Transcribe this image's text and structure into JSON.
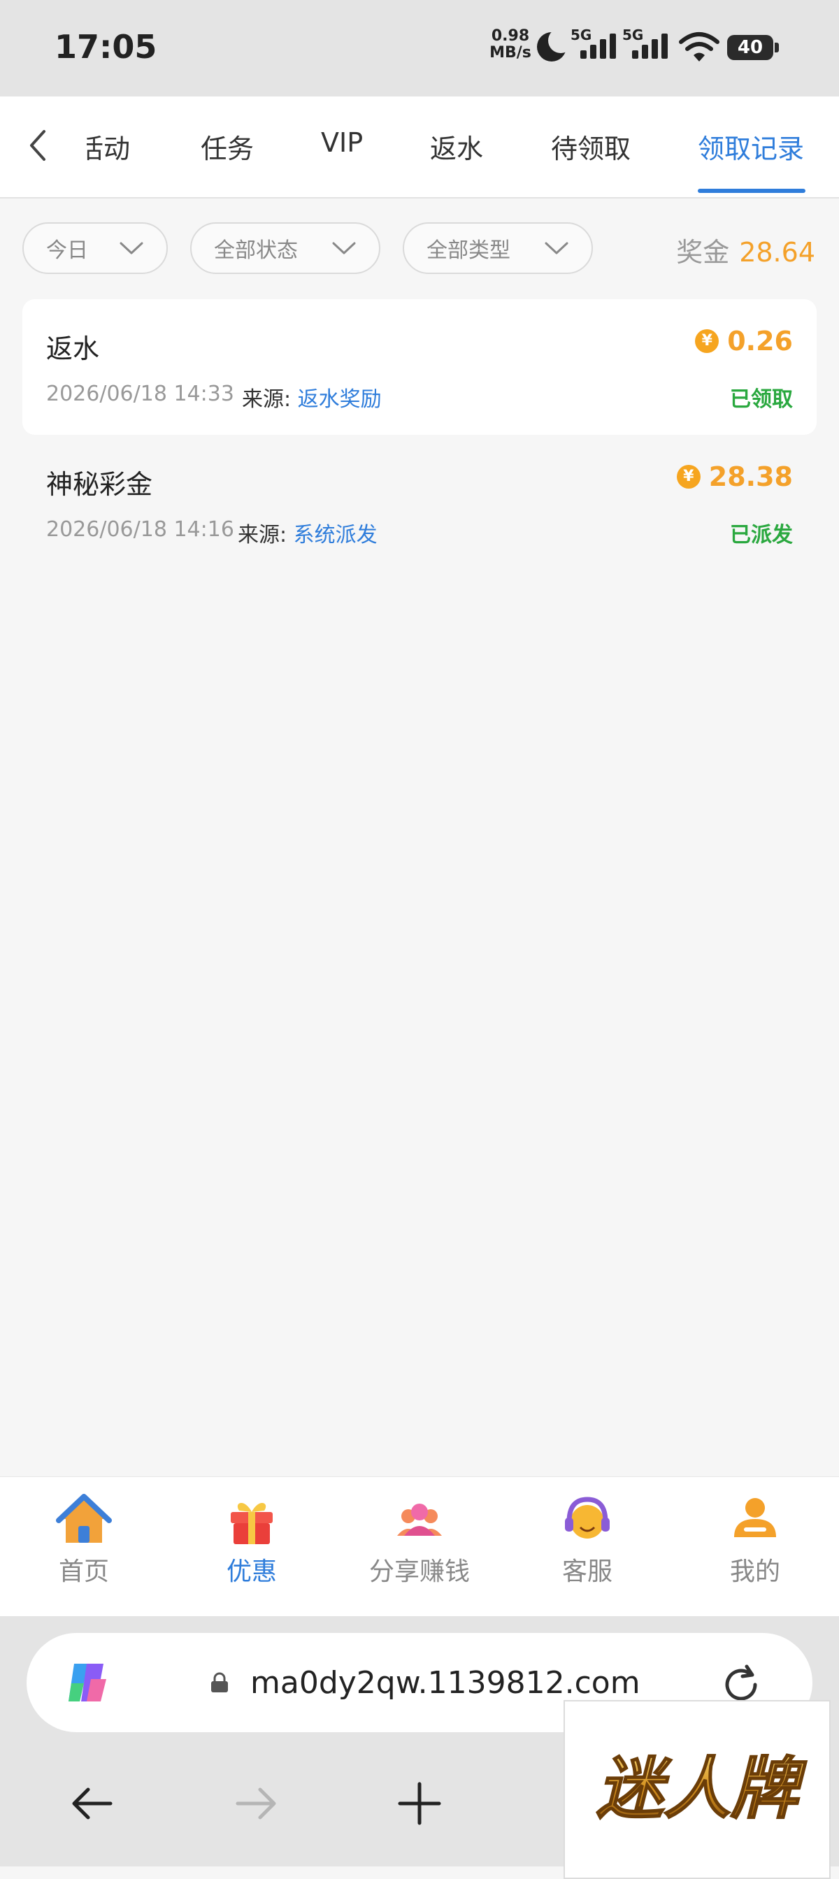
{
  "status_bar": {
    "time": "17:05",
    "net_speed_value": "0.98",
    "net_speed_unit": "MB/s",
    "sim1": "5G",
    "sim2": "5G",
    "battery": "40"
  },
  "tabs": [
    {
      "label": "活动",
      "shown": "活动"
    },
    {
      "label": "任务"
    },
    {
      "label": "VIP"
    },
    {
      "label": "返水"
    },
    {
      "label": "待领取"
    },
    {
      "label": "领取记录"
    }
  ],
  "filters": {
    "date": "今日",
    "status": "全部状态",
    "type": "全部类型"
  },
  "bonus": {
    "label": "奖金",
    "value": "28.64"
  },
  "records": [
    {
      "title": "返水",
      "datetime": "2026/06/18 14:33",
      "source_label": "来源:",
      "source": "返水奖励",
      "amount": "0.26",
      "status": "已领取"
    },
    {
      "title": "神秘彩金",
      "datetime": "2026/06/18 14:16",
      "source_label": "来源:",
      "source": "系统派发",
      "amount": "28.38",
      "status": "已派发"
    }
  ],
  "coin_symbol": "¥",
  "bottom_nav": [
    {
      "label": "首页",
      "icon": "home-icon"
    },
    {
      "label": "优惠",
      "icon": "gift-icon"
    },
    {
      "label": "分享赚钱",
      "icon": "people-icon"
    },
    {
      "label": "客服",
      "icon": "headset-icon"
    },
    {
      "label": "我的",
      "icon": "user-icon"
    }
  ],
  "browser": {
    "url": "ma0dy2qw.1139812.com"
  },
  "watermark": "迷人牌",
  "colors": {
    "accent": "#2f7ddb",
    "gold": "#f4a12a",
    "success": "#2aa83f"
  }
}
